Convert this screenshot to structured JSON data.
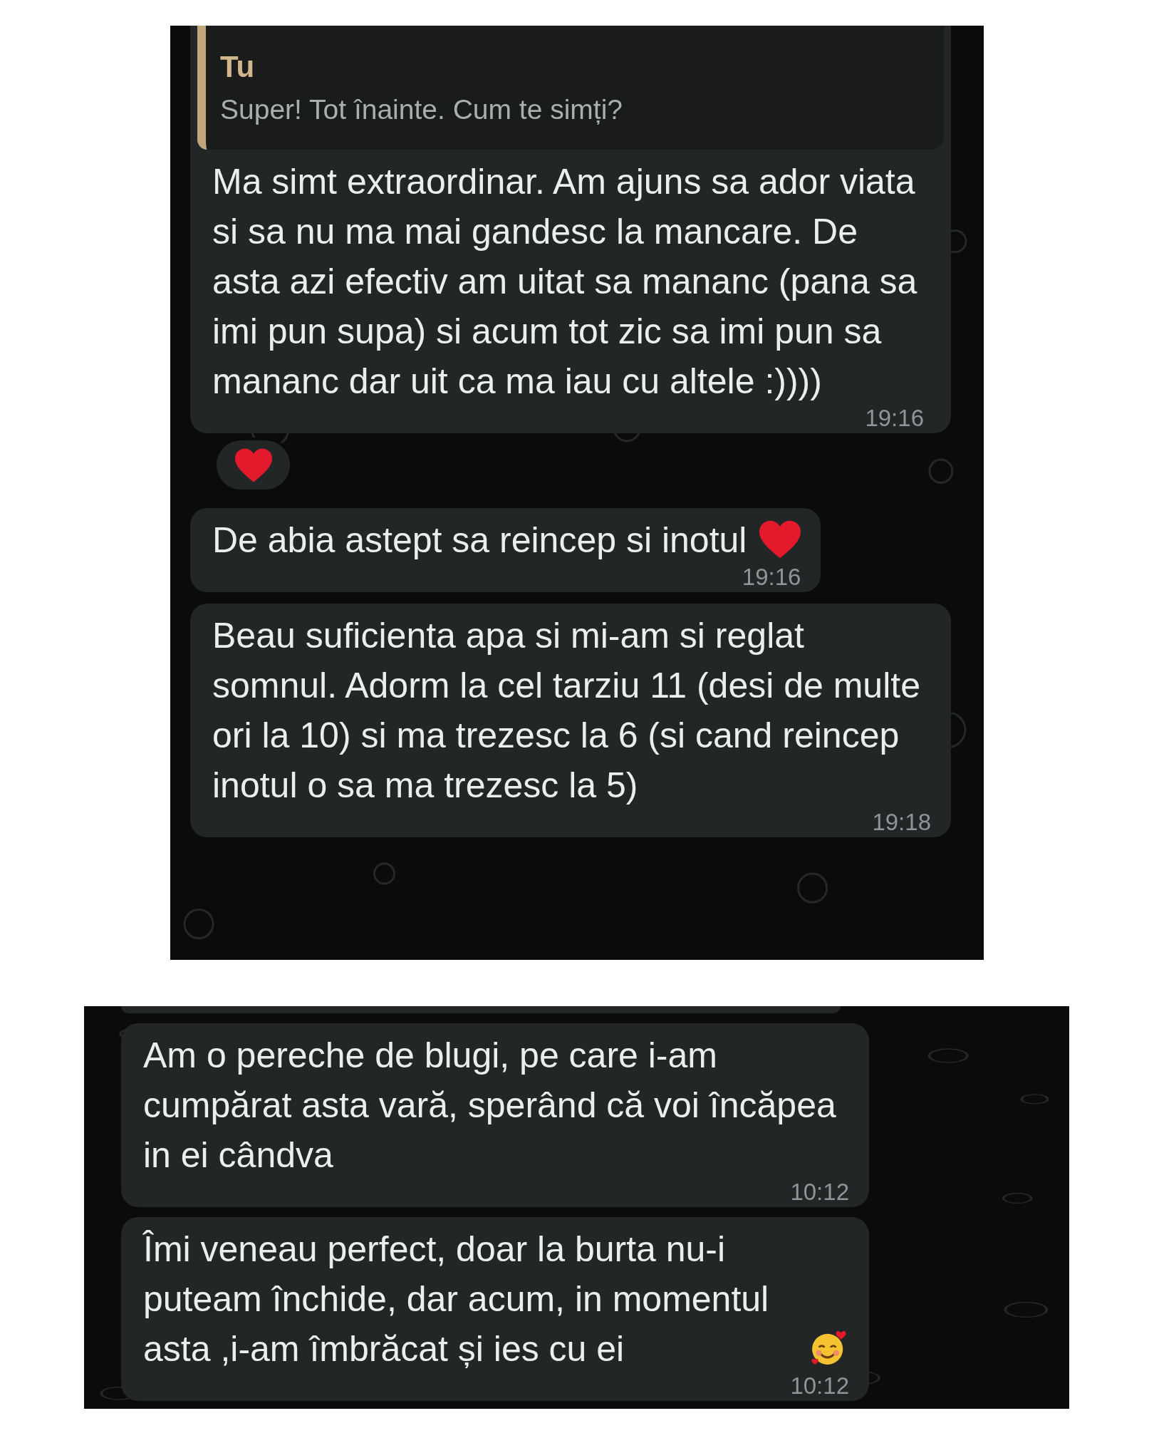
{
  "panels": [
    {
      "messages": [
        {
          "kind": "text",
          "quote": {
            "author": "Tu",
            "text": "Super! Tot înainte. Cum te simți?"
          },
          "text": "Ma simt extraordinar. Am ajuns sa ador viata si sa nu ma mai gandesc la mancare. De asta azi efectiv am uitat sa mananc (pana sa imi pun supa) si acum tot zic sa imi pun sa mananc dar uit ca ma iau cu altele :))))",
          "time": "19:16",
          "heart_reaction": true
        },
        {
          "kind": "text",
          "text": "De abia astept sa reincep si inotul",
          "heart_emoji": true,
          "time": "19:16"
        },
        {
          "kind": "text",
          "text": "Beau suficienta apa si mi-am si reglat somnul. Adorm la cel tarziu 11 (desi de multe ori la 10) si ma trezesc la 6 (si cand reincep inotul o sa ma trezesc la 5)",
          "time": "19:18"
        }
      ]
    },
    {
      "messages": [
        {
          "kind": "stub"
        },
        {
          "kind": "text",
          "text": "Am o pereche de blugi, pe care i-am cumpărat asta vară, sperând că voi încăpea in ei cândva",
          "time": "10:12"
        },
        {
          "kind": "text",
          "text": "Îmi veneau perfect, doar la burta nu-i puteam închide, dar acum, in momentul asta ,i-am îmbrăcat și ies cu ei",
          "smiling_emoji": true,
          "time": "10:12"
        }
      ]
    }
  ]
}
